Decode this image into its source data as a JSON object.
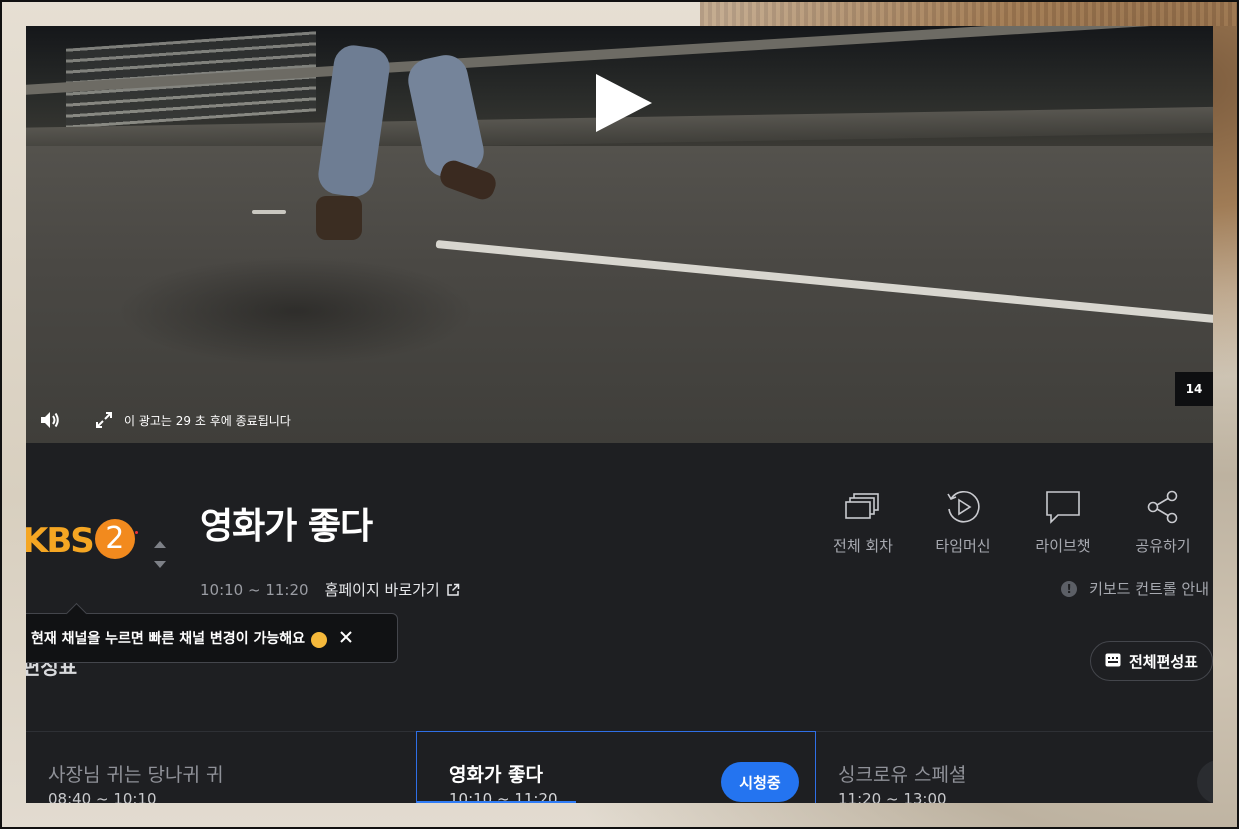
{
  "video": {
    "ad_message": "이 광고는 29 초 후에 종료됩니다",
    "badge": "14"
  },
  "channel": {
    "logo_text": "KBS",
    "logo_number": "2"
  },
  "program": {
    "title": "영화가 좋다",
    "time": "10:10 ~ 11:20",
    "homepage_link": "홈페이지 바로가기"
  },
  "actions": [
    {
      "label": "전체 회차",
      "icon": "episodes-icon"
    },
    {
      "label": "타임머신",
      "icon": "timemachine-icon"
    },
    {
      "label": "라이브챗",
      "icon": "chat-icon"
    },
    {
      "label": "공유하기",
      "icon": "share-icon"
    }
  ],
  "keyboard_guide": "키보드 컨트롤 안내",
  "tooltip": {
    "text": "현재 채널을 누르면 빠른 채널 변경이 가능해요"
  },
  "section_heading": "편성표",
  "full_schedule_button": "전체편성표",
  "schedule": [
    {
      "title": "사장님 귀는 당나귀 귀",
      "time": "08:40 ~ 10:10"
    },
    {
      "title": "영화가 좋다",
      "time": "10:10 ~ 11:20",
      "badge": "시청중",
      "progress": 0.4
    },
    {
      "title": "싱크로유 스페셜",
      "time": "11:20 ~ 13:00"
    }
  ],
  "colors": {
    "background": "#1e1f22",
    "accent": "#2474f0",
    "logo": "#f5a623"
  }
}
